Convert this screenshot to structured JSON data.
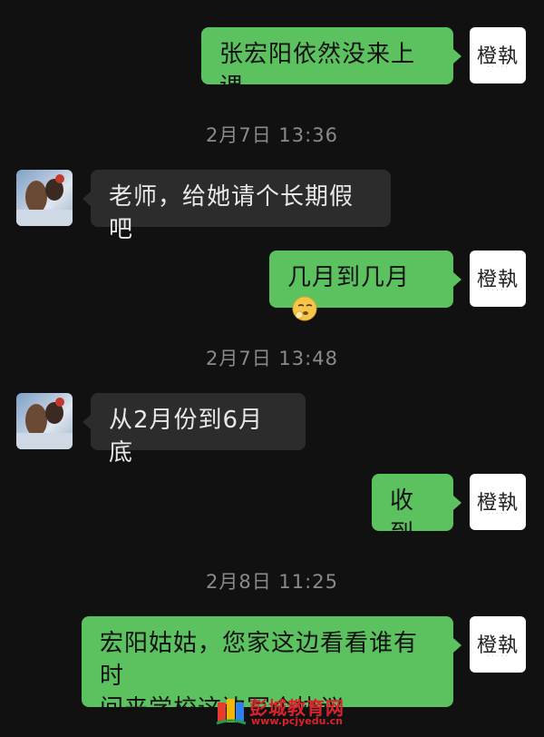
{
  "messages": [
    {
      "side": "out",
      "text": "张宏阳依然没来上课"
    },
    {
      "timestamp": "2月7日 13:36"
    },
    {
      "side": "in",
      "text": "老师，给她请个长期假吧"
    },
    {
      "side": "out",
      "text": "几月到几月",
      "emoji": "face-emoji"
    },
    {
      "timestamp": "2月7日 13:48"
    },
    {
      "side": "in",
      "text": "从2月份到6月底"
    },
    {
      "side": "out",
      "text": "收到"
    },
    {
      "timestamp": "2月8日 11:25"
    },
    {
      "side": "out",
      "text": "宏阳姑姑，您家这边看看谁有时间来学校这边写个协议",
      "lines": [
        "宏阳姑姑，您家这边看看谁有时",
        "间来学校这边写个协议"
      ]
    }
  ],
  "self_avatar": {
    "logo_text": "橙執"
  },
  "watermark": {
    "title": "彭城教育网",
    "url": "www.pcjyedu.cn"
  },
  "colors": {
    "background": "#111111",
    "outgoing_bubble": "#5bc25f",
    "incoming_bubble": "#2c2c2c",
    "timestamp": "#8a8a8a",
    "watermark": "#d9232d"
  }
}
